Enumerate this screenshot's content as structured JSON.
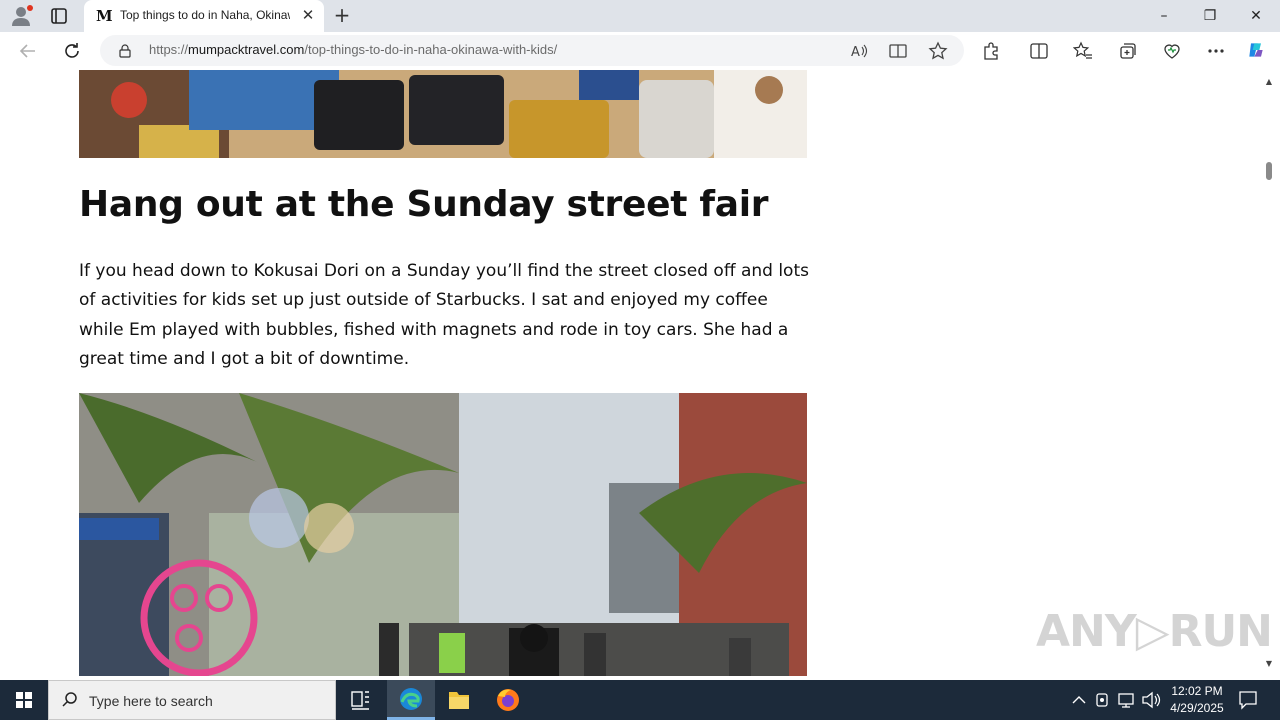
{
  "browser": {
    "tab": {
      "favicon_letter": "M",
      "title": "Top things to do in Naha, Okinawa with kids",
      "close_icon": "close-icon"
    },
    "new_tab_glyph": "+",
    "window_controls": {
      "minimize": "–",
      "restore": "❐",
      "close": "✕"
    },
    "url": {
      "prefix": "https://",
      "domain": "mumpacktravel.com",
      "path": "/top-things-to-do-in-naha-okinawa-with-kids/"
    }
  },
  "article": {
    "heading": "Hang out at the Sunday street fair",
    "paragraph": "If you head down to Kokusai Dori on a Sunday you’ll find the street closed off and lots of activities for kids set up just outside of Starbucks. I sat and enjoyed my coffee while Em played with bubbles, fished with magnets and rode in toy cars. She had a great time and I got a bit of downtime."
  },
  "watermark": "ANY▷RUN",
  "taskbar": {
    "search_placeholder": "Type here to search",
    "time": "12:02 PM",
    "date": "4/29/2025"
  },
  "colors": {
    "tabbar_bg": "#dfe3e9",
    "taskbar_bg": "#1c2a3a",
    "accent": "#0a68c8"
  }
}
